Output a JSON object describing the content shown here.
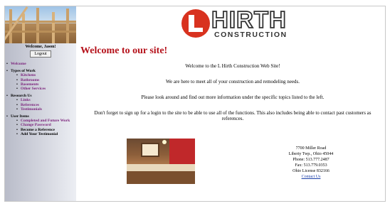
{
  "sidebar": {
    "welcome_text": "Welcome, Jason!",
    "logout_label": "Logout",
    "nav": [
      {
        "label": "Welcome",
        "color": "purple"
      },
      {
        "label": "Types of Work",
        "color": "black",
        "children": [
          "Kitchens",
          "Bathrooms",
          "Basements",
          "Other Services"
        ]
      },
      {
        "label": "Research Us",
        "color": "black",
        "children": [
          "Links",
          "References",
          "Testimonials"
        ]
      },
      {
        "label": "User Items",
        "color": "black",
        "children": [
          "Completed and Future Work",
          "Change Password",
          "Become a Reference",
          "Add Your Testimonial"
        ]
      }
    ]
  },
  "logo": {
    "word": "HIRTH",
    "subtitle": "CONSTRUCTION"
  },
  "main": {
    "heading": "Welcome to our site!",
    "paragraphs": [
      "Welcome to the L Hirth Construction Web Site!",
      "We are here to meet all of your construction and remodeling needs.",
      "Please look around and find out more information under the specific topics listed to the left.",
      "Don't forget to sign up for a login to the site to be able to use all of the functions. This also includes being able to contact past customers as references."
    ]
  },
  "address": {
    "line1": "7700 Miller Road",
    "line2": "Liberty Twp., Ohio 45044",
    "phone": "Phone: 513.777.2487",
    "fax": "Fax: 513.779.0353",
    "license": "Ohio License 832166",
    "contact_link": "Contact Us"
  },
  "colors": {
    "heading": "#b5121b",
    "nav_link": "#7a1f7a",
    "logo_red": "#d8321f",
    "link": "#1a3ea8"
  }
}
